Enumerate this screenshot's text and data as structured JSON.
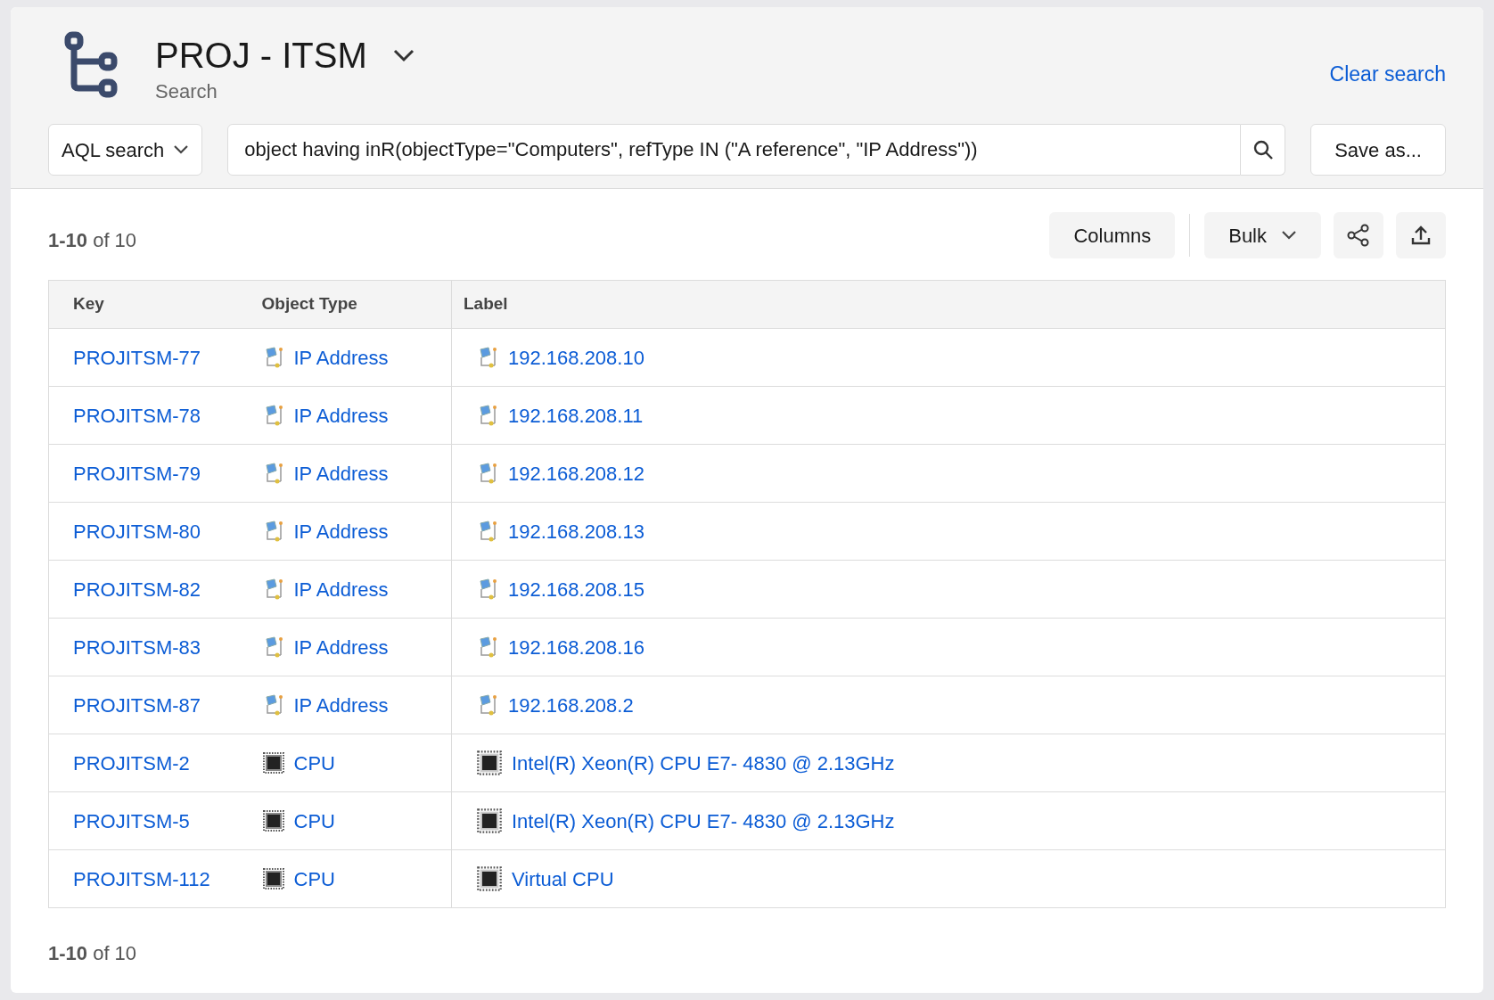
{
  "header": {
    "title": "PROJ - ITSM",
    "subtitle": "Search",
    "clear_link": "Clear search"
  },
  "search": {
    "mode": "AQL search",
    "query": "object having inR(objectType=\"Computers\", refType IN (\"A reference\", \"IP Address\"))",
    "save_button": "Save as..."
  },
  "toolbar": {
    "count": "**1-10** of 10",
    "columns_button": "Columns",
    "bulk_button": "Bulk"
  },
  "table": {
    "columns": [
      "Key",
      "Object Type",
      "Label"
    ],
    "rows": [
      {
        "key": "PROJITSM-77",
        "kind": "ip",
        "type": "IP Address",
        "label": "192.168.208.10"
      },
      {
        "key": "PROJITSM-78",
        "kind": "ip",
        "type": "IP Address",
        "label": "192.168.208.11"
      },
      {
        "key": "PROJITSM-79",
        "kind": "ip",
        "type": "IP Address",
        "label": "192.168.208.12"
      },
      {
        "key": "PROJITSM-80",
        "kind": "ip",
        "type": "IP Address",
        "label": "192.168.208.13"
      },
      {
        "key": "PROJITSM-82",
        "kind": "ip",
        "type": "IP Address",
        "label": "192.168.208.15"
      },
      {
        "key": "PROJITSM-83",
        "kind": "ip",
        "type": "IP Address",
        "label": "192.168.208.16"
      },
      {
        "key": "PROJITSM-87",
        "kind": "ip",
        "type": "IP Address",
        "label": "192.168.208.2"
      },
      {
        "key": "PROJITSM-2",
        "kind": "cpu",
        "type": "CPU",
        "label": "Intel(R) Xeon(R) CPU E7- 4830 @ 2.13GHz"
      },
      {
        "key": "PROJITSM-5",
        "kind": "cpu",
        "type": "CPU",
        "label": "Intel(R) Xeon(R) CPU E7- 4830 @ 2.13GHz"
      },
      {
        "key": "PROJITSM-112",
        "kind": "cpu",
        "type": "CPU",
        "label": "Virtual CPU"
      }
    ]
  },
  "footer": {
    "count": "**1-10** of 10"
  }
}
